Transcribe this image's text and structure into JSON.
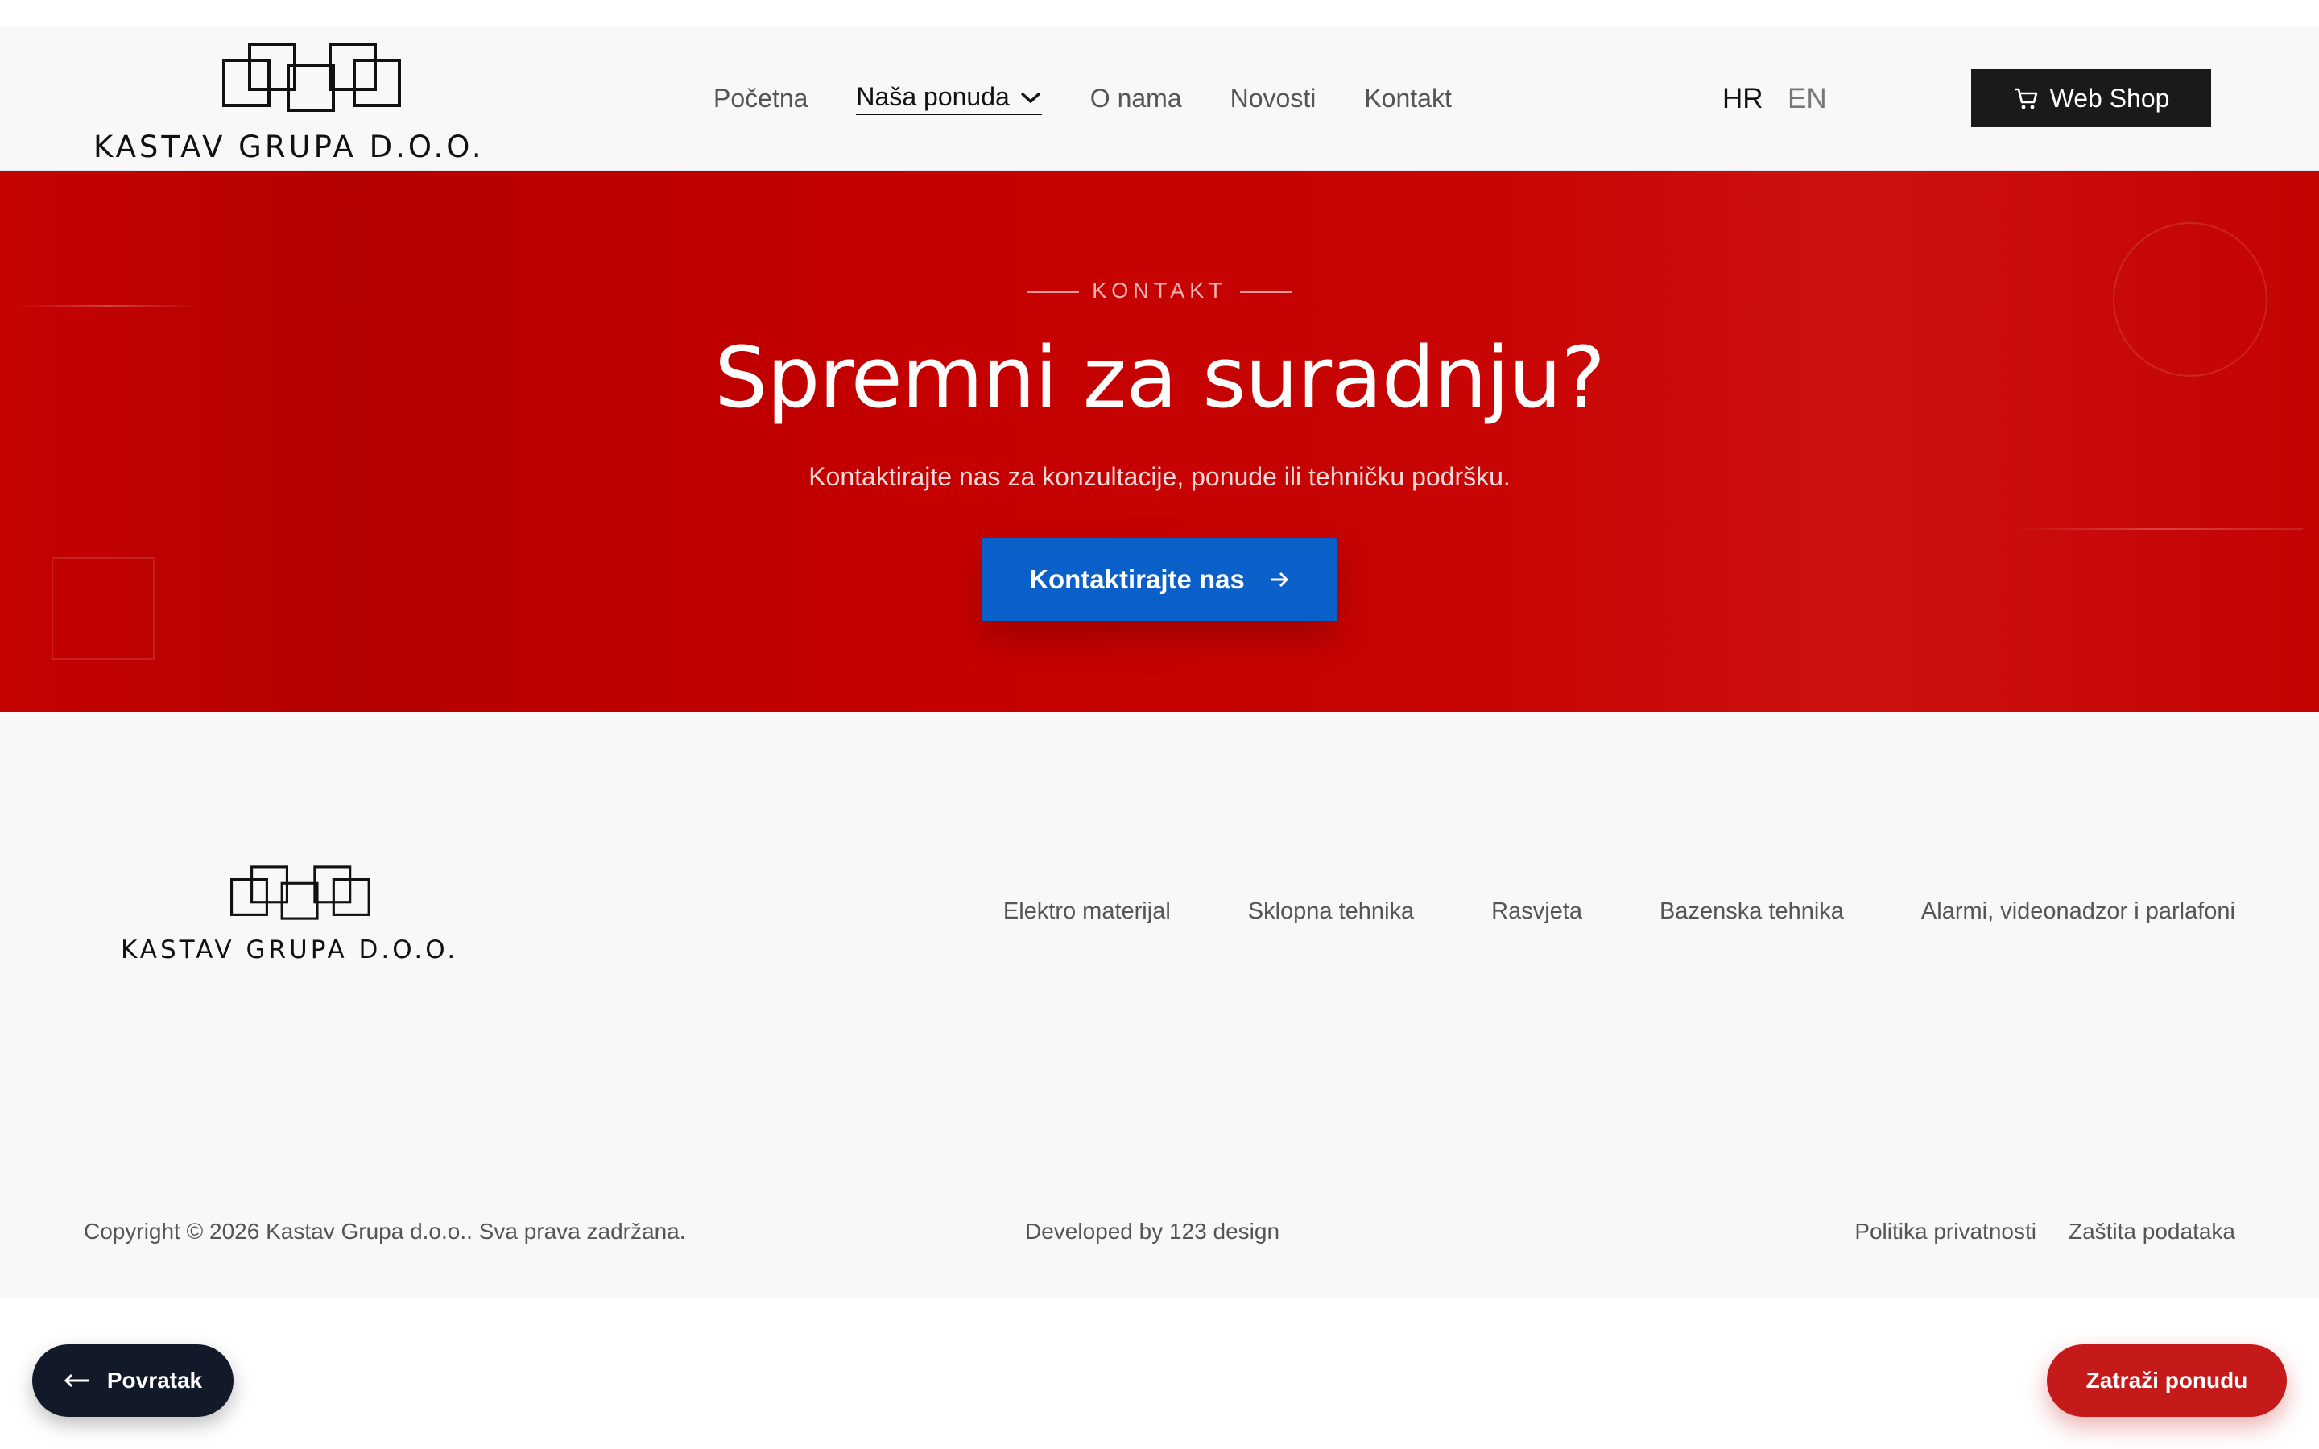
{
  "brand": {
    "name": "KASTAV GRUPA D.O.O.",
    "logo_icon": "interlocking-squares-logo-icon"
  },
  "nav": {
    "items": [
      {
        "label": "Početna",
        "active": false
      },
      {
        "label": "Naša ponuda",
        "active": true,
        "has_dropdown": true
      },
      {
        "label": "O nama",
        "active": false
      },
      {
        "label": "Novosti",
        "active": false
      },
      {
        "label": "Kontakt",
        "active": false
      }
    ]
  },
  "lang": {
    "hr": "HR",
    "en": "EN",
    "selected": "HR"
  },
  "webshop": {
    "label": "Web Shop",
    "icon": "cart-icon"
  },
  "hero": {
    "eyebrow": "KONTAKT",
    "title": "Spremni za suradnju?",
    "subtitle": "Kontaktirajte nas za konzultacije, ponude ili tehničku podršku.",
    "cta_label": "Kontaktirajte nas",
    "cta_icon": "arrow-right-icon"
  },
  "footer": {
    "links": [
      "Elektro materijal",
      "Sklopna tehnika",
      "Rasvjeta",
      "Bazenska tehnika",
      "Alarmi, videonadzor i parlafoni"
    ],
    "copyright": "Copyright © 2026 Kastav Grupa d.o.o.. Sva prava zadržana.",
    "developed": "Developed by 123 design",
    "legal": [
      "Politika privatnosti",
      "Zaštita podataka"
    ]
  },
  "floating": {
    "back_label": "Povratak",
    "back_icon": "arrow-left-icon",
    "quote_label": "Zatraži ponudu"
  },
  "colors": {
    "hero_red": "#c40000",
    "cta_blue": "#0a5fc9",
    "webshop_dark": "#1a1a1a",
    "back_navy": "#121a2a",
    "quote_red": "#c41a1a"
  }
}
